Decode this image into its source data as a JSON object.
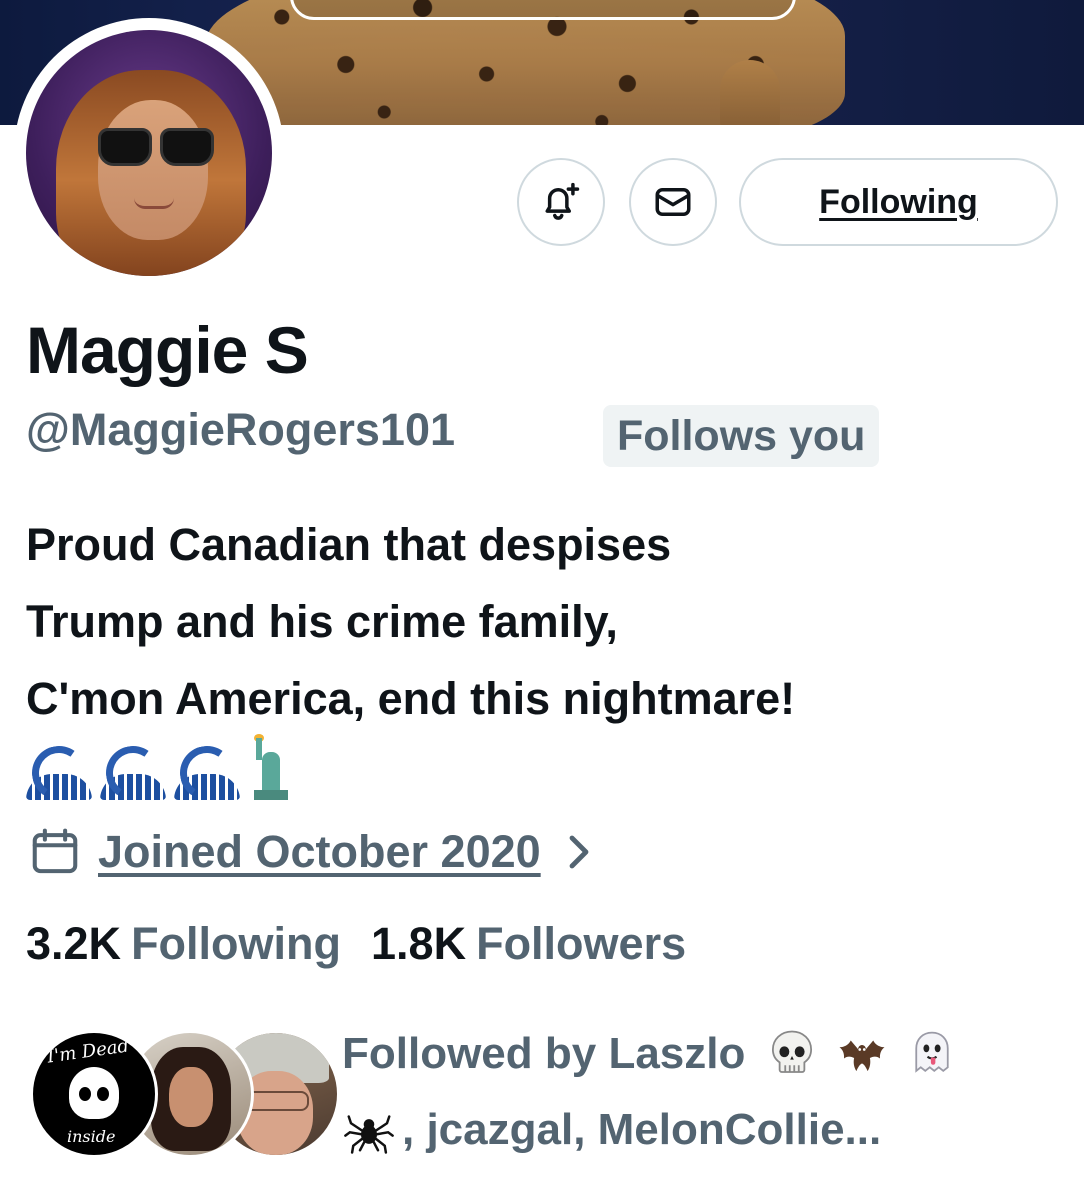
{
  "header": {
    "banner_icon": "leopard-cat-photo"
  },
  "profile": {
    "avatar_icon": "profile-photo",
    "name": "Maggie S",
    "handle": "@MaggieRogers101",
    "follows_you_badge": "Follows you",
    "bio_lines": [
      "Proud Canadian that despises",
      "Trump and his crime family,",
      "C'mon America, end this nightmare!"
    ],
    "bio_emojis": [
      "water-wave-icon",
      "water-wave-icon",
      "water-wave-icon",
      "statue-of-liberty-icon"
    ],
    "joined": "Joined October 2020",
    "following_count": "3.2K",
    "following_label": "Following",
    "followers_count": "1.8K",
    "followers_label": "Followers"
  },
  "actions": {
    "notify_icon": "bell-plus-icon",
    "message_icon": "envelope-icon",
    "following_button": "Following"
  },
  "followed_by": {
    "line1_text": "Followed by Laszlo",
    "line1_emojis": [
      "skull-icon",
      "bat-icon",
      "ghost-icon"
    ],
    "line2_emoji": "spider-icon",
    "line2_text": ", jcazgal, MelonCollie...",
    "avatar1_text_top": "I'm Dead",
    "avatar1_text_bottom": "inside"
  },
  "colors": {
    "primary_text": "#0f1419",
    "secondary_text": "#536471",
    "border": "#cfd9de",
    "badge_bg": "#eff3f4"
  }
}
